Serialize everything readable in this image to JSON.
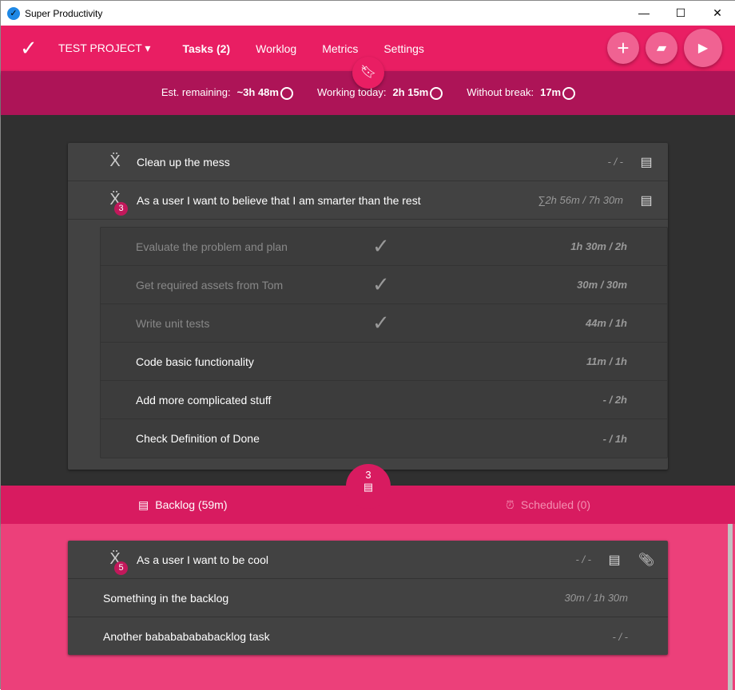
{
  "window": {
    "title": "Super Productivity",
    "minimize": "—",
    "maximize": "☐",
    "close": "✕"
  },
  "header": {
    "project": "TEST PROJECT",
    "nav": [
      "Tasks (2)",
      "Worklog",
      "Metrics",
      "Settings"
    ]
  },
  "stats": {
    "est_label": "Est. remaining:",
    "est_value": "~3h 48m",
    "working_label": "Working today:",
    "working_value": "2h 15m",
    "break_label": "Without break:",
    "break_value": "17m"
  },
  "tasks": [
    {
      "title": "Clean up the mess",
      "time": "- / -"
    },
    {
      "title": "As a user I want to believe that I am smarter than the rest",
      "time": "∑2h 56m / 7h 30m",
      "badge": "3"
    }
  ],
  "subtasks": [
    {
      "title": "Evaluate the problem and plan",
      "time": "1h 30m / 2h",
      "done": true
    },
    {
      "title": "Get required assets from Tom",
      "time": "30m / 30m",
      "done": true
    },
    {
      "title": "Write unit tests",
      "time": "44m / 1h",
      "done": true
    },
    {
      "title": "Code basic functionality",
      "time": "11m / 1h",
      "done": false
    },
    {
      "title": "Add more complicated stuff",
      "time": "- / 2h",
      "done": false
    },
    {
      "title": "Check Definition of Done",
      "time": "- / 1h",
      "done": false
    }
  ],
  "backlog_bar": {
    "count": "3",
    "backlog": "Backlog (59m)",
    "scheduled": "Scheduled (0)"
  },
  "backlog": [
    {
      "title": "As a user I want to be cool",
      "time": "- / -",
      "badge": "5"
    },
    {
      "title": "Something in the backlog",
      "time": "30m / 1h 30m"
    },
    {
      "title": "Another babababababacklog task",
      "time": "- / -"
    }
  ]
}
